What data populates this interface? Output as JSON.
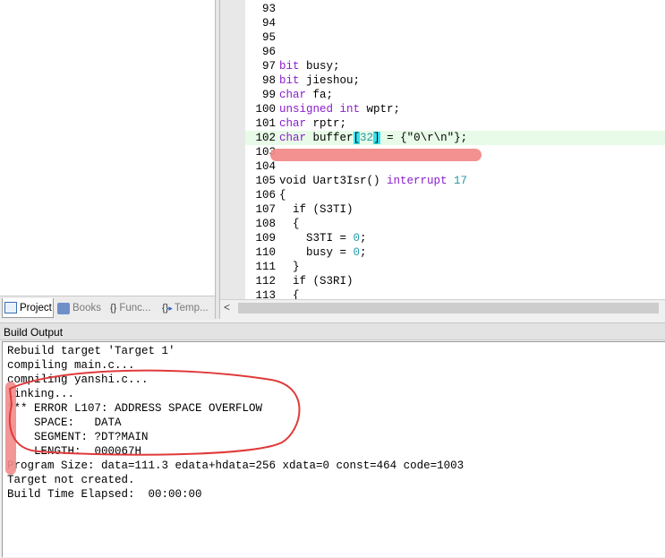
{
  "project_tabs": [
    {
      "label": "Project",
      "icon": "project-icon",
      "active": true
    },
    {
      "label": "Books",
      "icon": "books-icon",
      "active": false
    },
    {
      "label": "Func...",
      "icon": "functions-icon",
      "active": false
    },
    {
      "label": "Temp...",
      "icon": "templates-icon",
      "active": false
    }
  ],
  "editor": {
    "highlight_color": "#e8fbe8",
    "lines": [
      {
        "n": "93",
        "text": ""
      },
      {
        "n": "94",
        "text": ""
      },
      {
        "n": "95",
        "text": ""
      },
      {
        "n": "96",
        "text": ""
      },
      {
        "n": "97",
        "kw": "bit",
        "rest": " busy;"
      },
      {
        "n": "98",
        "kw": "bit",
        "rest": " jieshou;"
      },
      {
        "n": "99",
        "kw": "char",
        "rest": " fa;"
      },
      {
        "n": "100",
        "kw": "unsigned int",
        "rest": " wptr;"
      },
      {
        "n": "101",
        "kw": "char",
        "rest": " rptr;"
      },
      {
        "n": "102",
        "kw": "char",
        "pre": " buffer",
        "open": "[",
        "num": "32",
        "close": "]",
        "post": " = {\"0\\r\\n\"};"
      },
      {
        "n": "103",
        "text": ""
      },
      {
        "n": "104",
        "text": ""
      },
      {
        "n": "105",
        "pre": "void Uart3Isr() ",
        "kw": "interrupt",
        "num": " 17"
      },
      {
        "n": "106",
        "text": "{"
      },
      {
        "n": "107",
        "text": "  if (S3TI)"
      },
      {
        "n": "108",
        "text": "  {"
      },
      {
        "n": "109",
        "pre": "    S3TI = ",
        "num": "0",
        "post": ";"
      },
      {
        "n": "110",
        "pre": "    busy = ",
        "num": "0",
        "post": ";"
      },
      {
        "n": "111",
        "text": "  }"
      },
      {
        "n": "112",
        "text": "  if (S3RI)"
      },
      {
        "n": "113",
        "text": "  {"
      }
    ]
  },
  "build_output": {
    "title": "Build Output",
    "lines": [
      "Rebuild target 'Target 1'",
      "compiling main.c...",
      "compiling yanshi.c...",
      "linking...",
      "*** ERROR L107: ADDRESS SPACE OVERFLOW",
      "    SPACE:   DATA",
      "    SEGMENT: ?DT?MAIN",
      "    LENGTH:  000067H",
      "Program Size: data=111.3 edata+hdata=256 xdata=0 const=464 code=1003",
      "Target not created.",
      "Build Time Elapsed:  00:00:00"
    ]
  },
  "scroll_left_arrow": "<",
  "annotation_color": "#e03a3a"
}
